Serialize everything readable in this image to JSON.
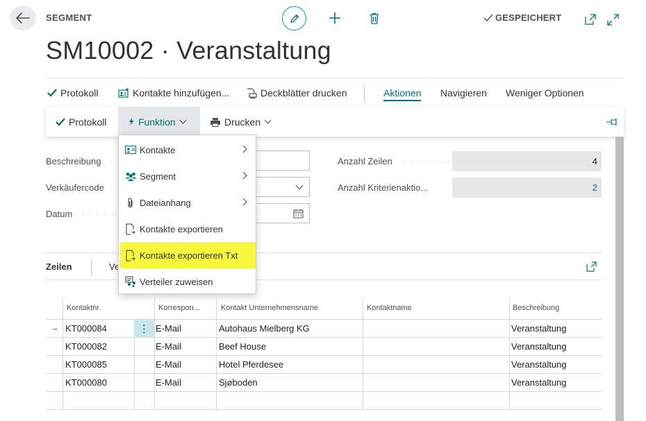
{
  "header": {
    "crumb": "SEGMENT",
    "saved_label": "GESPEICHERT"
  },
  "page": {
    "title": "SM10002 · Veranstaltung"
  },
  "actionbar": {
    "protokoll": "Protokoll",
    "kontakte_hinzufuegen": "Kontakte hinzufügen...",
    "deckblaetter": "Deckblätter drucken",
    "aktionen": "Aktionen",
    "navigieren": "Navigieren",
    "weniger": "Weniger Optionen"
  },
  "subbar": {
    "protokoll": "Protokoll",
    "funktion": "Funktion",
    "drucken": "Drucken"
  },
  "form": {
    "beschreibung_label": "Beschreibung",
    "verkaeufercode_label": "Verkäufercode",
    "datum_label": "Datum",
    "anzahl_zeilen_label": "Anzahl Zeilen",
    "anzahl_zeilen_value": "4",
    "anzahl_kriterien_label": "Anzahl Kriterienaktio...",
    "anzahl_kriterien_value": "2"
  },
  "lines": {
    "title": "Zeilen",
    "tab": "Ve"
  },
  "grid": {
    "columns": [
      "Kontaktnr.",
      "Korrespon...",
      "Kontakt Unternehmensname",
      "Kontaktname",
      "Beschreibung"
    ],
    "rows": [
      [
        "KT000084",
        "E-Mail",
        "Autohaus Mielberg KG",
        "",
        "Veranstaltung"
      ],
      [
        "KT000082",
        "E-Mail",
        "Beef House",
        "",
        "Veranstaltung"
      ],
      [
        "KT000085",
        "E-Mail",
        "Hotel Pferdesee",
        "",
        "Veranstaltung"
      ],
      [
        "KT000080",
        "E-Mail",
        "Sjøboden",
        "",
        "Veranstaltung"
      ]
    ],
    "row_marker": "→",
    "kebab": "⋮"
  },
  "menu": {
    "items": [
      {
        "label": "Kontakte",
        "icon": "contact-card-icon",
        "submenu": true
      },
      {
        "label": "Segment",
        "icon": "people-group-icon",
        "submenu": true
      },
      {
        "label": "Dateianhang",
        "icon": "paperclip-icon",
        "submenu": true
      },
      {
        "label": "Kontakte exportieren",
        "icon": "document-export-icon",
        "submenu": false
      },
      {
        "label": "Kontakte exportieren Txt",
        "icon": "document-export-icon",
        "submenu": false
      },
      {
        "label": "Verteiler zuweisen",
        "icon": "assign-distribution-icon",
        "submenu": false
      }
    ],
    "highlighted_index": 4
  },
  "colors": {
    "accent": "#00727a",
    "accent_light": "#00a1a7",
    "highlight": "#f7f73d",
    "panel_gray": "#e7e7e7",
    "check_green": "#0c6b3f"
  }
}
